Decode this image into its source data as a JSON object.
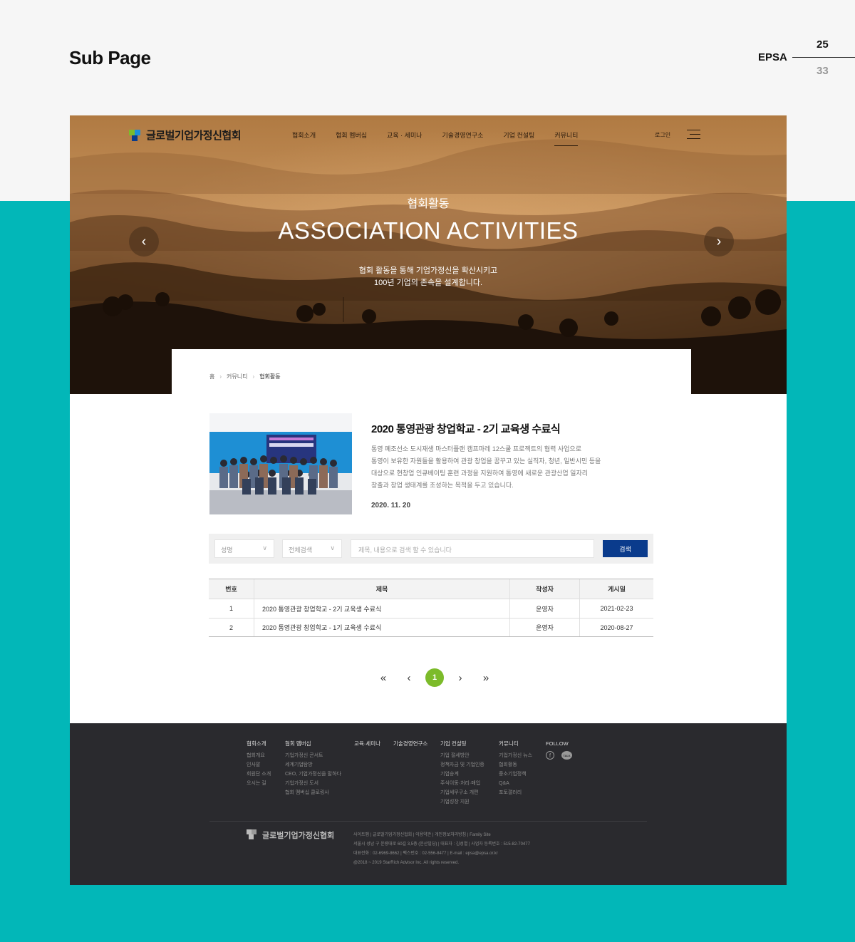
{
  "presentation": {
    "title": "Sub Page",
    "brand": "EPSA",
    "current_page": "25",
    "total_pages": "33",
    "colors": {
      "band": "#02b7b8",
      "background": "#f6f6f6"
    }
  },
  "header": {
    "logo_text": "글로벌기업가정신협회",
    "nav": [
      "협회소개",
      "협회 멤버십",
      "교육 · 세미나",
      "기술경영연구소",
      "기업 컨설팅",
      "커뮤니티"
    ],
    "active_nav": "커뮤니티",
    "login": "로그인",
    "menu_icon": "hamburger-icon"
  },
  "hero": {
    "subtitle": "협회활동",
    "title": "ASSOCIATION ACTIVITIES",
    "desc_line1": "협회 활동을 통해 기업가정신을 확산시키고",
    "desc_line2": "100년 기업의 존속을 설계합니다.",
    "prev_icon": "chevron-left-icon",
    "next_icon": "chevron-right-icon"
  },
  "breadcrumb": [
    "홈",
    "커뮤니티",
    "협회활동"
  ],
  "feature": {
    "title": "2020 통영관광 창업학교 - 2기 교육생 수료식",
    "body": [
      "통영 폐조선소 도시재생 마스터플랜 캠프마레 12스쿨 프로젝트의 협력 사업으로",
      "통영이 보유한 자원들을 활용하여 관광 창업을 꿈꾸고 있는 실직자, 청년, 일반시민 등을",
      "대상으로 현창업 인큐베이팅 훈련 과정을 지원하여 통영에 새로운 관광산업 일자리",
      "창출과 창업 생태계를 조성하는 목적을 두고 있습니다."
    ],
    "date": "2020. 11. 20"
  },
  "search": {
    "select1": "성명",
    "select2": "전체검색",
    "placeholder": "제목, 내용으로 검색 할 수 있습니다",
    "button": "검색",
    "button_color": "#0a3b8c"
  },
  "board": {
    "headers": [
      "번호",
      "제목",
      "작성자",
      "게시일"
    ],
    "rows": [
      {
        "no": "1",
        "title": "2020 통영관광 창업학교 - 2기 교육생 수료식",
        "writer": "운영자",
        "date": "2021-02-23"
      },
      {
        "no": "2",
        "title": "2020 통영관광 창업학교 - 1기 교육생 수료식",
        "writer": "운영자",
        "date": "2020-08-27"
      }
    ]
  },
  "pagination": {
    "first": "«",
    "prev": "‹",
    "current": "1",
    "next": "›",
    "last": "»",
    "accent": "#7cbb2a"
  },
  "footer": {
    "columns": [
      {
        "heading": "협회소개",
        "items": [
          "협회개요",
          "인사말",
          "회원단 소개",
          "오시는 길"
        ]
      },
      {
        "heading": "협회 멤버십",
        "items": [
          "기업가정신 콘서트",
          "세계기업탐방",
          "CEO, 기업가정신을 말하다",
          "기업가정신 도서",
          "협회 멤버십 클로링사"
        ]
      },
      {
        "heading": "교육·세미나",
        "items": []
      },
      {
        "heading": "기술경영연구소",
        "items": []
      },
      {
        "heading": "기업 컨설팅",
        "items": [
          "기업 절세방안",
          "정책자금 및 기업인증",
          "기업승계",
          "주식이동·처리·매입",
          "기업세무구소 개편",
          "기업성장 지원"
        ]
      },
      {
        "heading": "커뮤니티",
        "items": [
          "기업가정신 뉴스",
          "협회활동",
          "중소기업정책",
          "Q&A",
          "포토갤러리"
        ]
      }
    ],
    "follow": "FOLLOW",
    "follow_icons": [
      "facebook-icon",
      "kakaotalk-icon"
    ],
    "kakao_label": "TALK",
    "logo_text": "글로벌기업가정신협회",
    "info": [
      "사이트맵 | 글로벌기업가정신협회 | 이용약관 | 개인정보처리방침 | Family Site",
      "서울시 성남 구 운량대로 60길 3,5층 (운산빌딩) | 대표자 : 김성열 | 사업자 등록번호 : 515-82-70477",
      "대표전화 : 02-6969-8662 | 팩스번호 : 02-556-8477 | E-mail : epsa@epsa.or.kr",
      "@2018 ~ 2019 StarRich Advisor Inc. All rights reserved."
    ]
  }
}
